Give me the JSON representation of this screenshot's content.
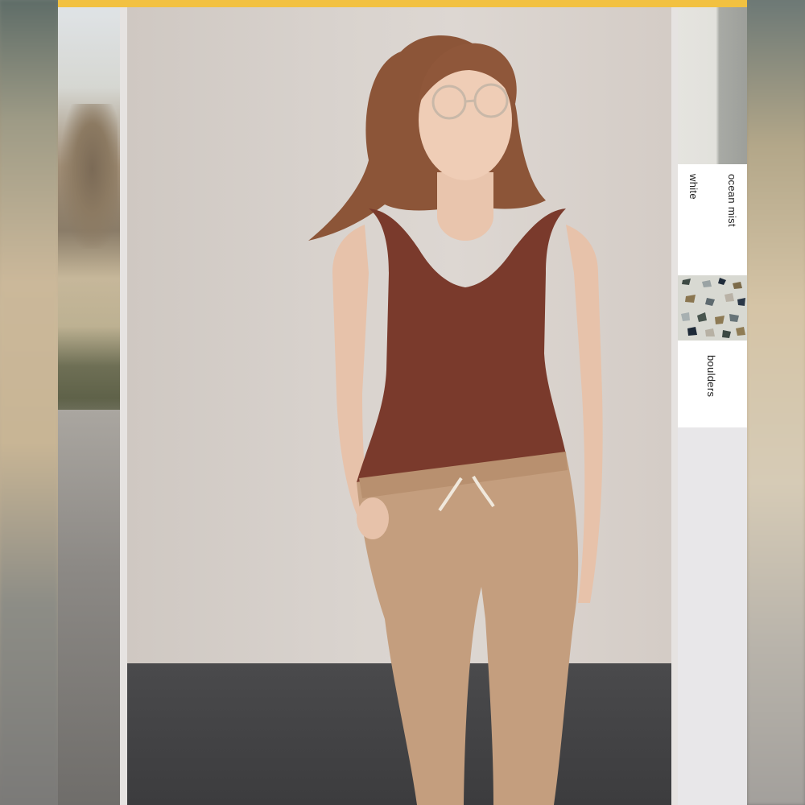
{
  "colors": {
    "accent_bar": "#f2c141",
    "frame_background": "#e6e3e1",
    "card_background": "#ffffff"
  },
  "photos": {
    "main": {
      "subject": "model",
      "tank_top_color": "#7a3a2c",
      "pants_color": "#c49e7e"
    }
  },
  "swatches": [
    {
      "label": "ocean mist"
    },
    {
      "label": "white"
    },
    {
      "label": "boulders"
    }
  ],
  "icons": {
    "boulders_pattern": "terrazzo-swatch"
  }
}
